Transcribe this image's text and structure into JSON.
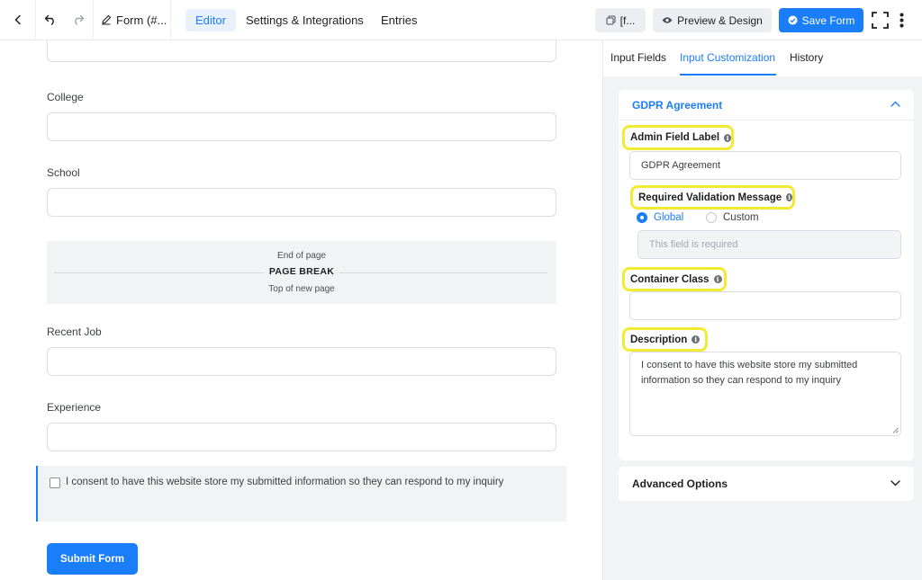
{
  "topbar": {
    "form_title": "Form (#...",
    "tabs": [
      {
        "label": "Editor",
        "active": true
      },
      {
        "label": "Settings & Integrations",
        "active": false
      },
      {
        "label": "Entries",
        "active": false
      }
    ],
    "shortcode_label": "[f...",
    "preview_label": "Preview & Design",
    "save_label": "Save Form"
  },
  "form": {
    "fields": [
      {
        "label": "College"
      },
      {
        "label": "School"
      },
      {
        "label": "Recent Job"
      },
      {
        "label": "Experience"
      }
    ],
    "page_break": {
      "end_text": "End of page",
      "title": "PAGE BREAK",
      "top_text": "Top of new page"
    },
    "gdpr_text": "I consent to have this website store my submitted information so they can respond to my inquiry",
    "submit_label": "Submit Form"
  },
  "panel": {
    "tabs": [
      {
        "label": "Input Fields",
        "active": false
      },
      {
        "label": "Input Customization",
        "active": true
      },
      {
        "label": "History",
        "active": false
      }
    ],
    "section_title": "GDPR Agreement",
    "admin_label": {
      "label": "Admin Field Label",
      "value": "GDPR Agreement"
    },
    "validation": {
      "label": "Required Validation Message",
      "options": [
        "Global",
        "Custom"
      ],
      "selected": "Global",
      "placeholder": "This field is required"
    },
    "container_class": {
      "label": "Container Class",
      "value": ""
    },
    "description": {
      "label": "Description",
      "value": "I consent to have this website store my submitted information so they can respond to my inquiry"
    },
    "advanced_label": "Advanced Options"
  },
  "colors": {
    "accent": "#1a7efb",
    "highlight": "#f2ea33",
    "panel_bg": "#f2f3f5"
  }
}
